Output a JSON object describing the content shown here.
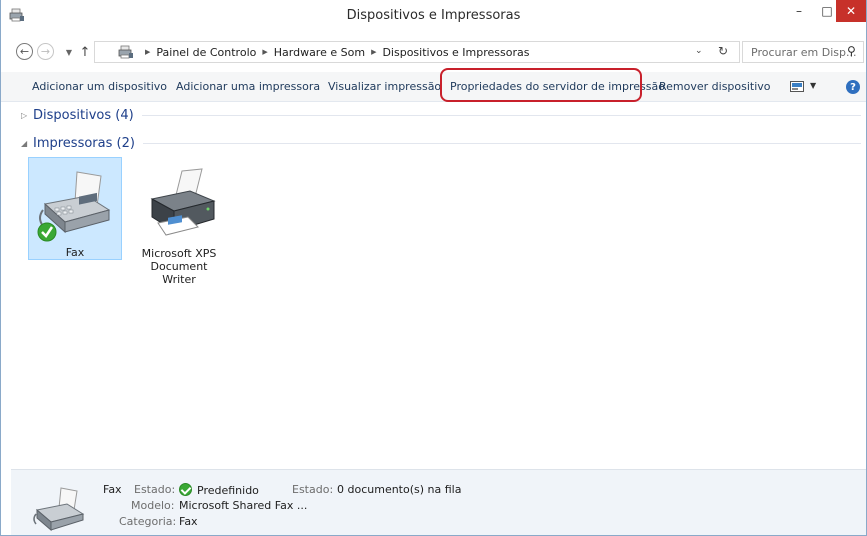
{
  "window": {
    "title": "Dispositivos e Impressoras",
    "min_glyph": "–",
    "max_glyph": "□",
    "close_glyph": "✕"
  },
  "address": {
    "crumbs": [
      "Painel de Controlo",
      "Hardware e Som",
      "Dispositivos e Impressoras"
    ],
    "search_placeholder": "Procurar em Disp..."
  },
  "commands": {
    "add_device": "Adicionar um dispositivo",
    "add_printer": "Adicionar uma impressora",
    "view_print": "Visualizar impressão",
    "server_props": "Propriedades do servidor de impressão",
    "remove_device": "Remover dispositivo",
    "help_glyph": "?"
  },
  "groups": {
    "devices": "Dispositivos (4)",
    "printers": "Impressoras (2)"
  },
  "items": [
    {
      "label": "Fax",
      "default": true
    },
    {
      "label": "Microsoft XPS Document Writer",
      "default": false
    }
  ],
  "details": {
    "name": "Fax",
    "status_label": "Estado:",
    "status_value": "Predefinido",
    "queue_label": "Estado:",
    "queue_value": "0 documento(s) na fila",
    "model_label": "Modelo:",
    "model_value": "Microsoft Shared Fax ...",
    "category_label": "Categoria:",
    "category_value": "Fax"
  },
  "colors": {
    "selection_bg": "#cce8ff",
    "highlight_border": "#c8202b",
    "close_button": "#c7312a"
  }
}
